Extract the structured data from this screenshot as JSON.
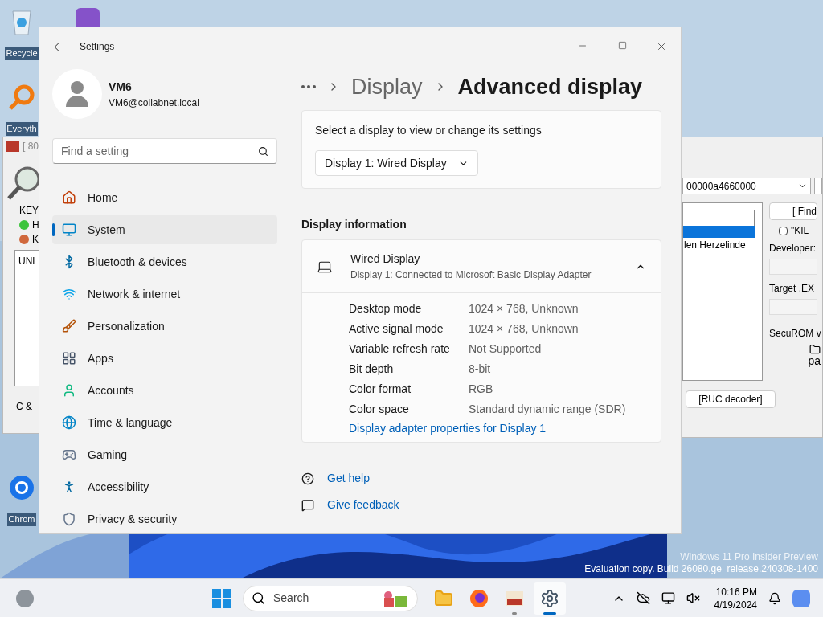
{
  "desktop": {
    "icons": [
      {
        "label": "Recycle"
      },
      {
        "label": "Everyth"
      },
      {
        "label": "Chrom"
      }
    ],
    "watermark": [
      "Windows 11 Pro Insider Preview",
      "Evaluation copy. Build 26080.ge_release.240308-1400"
    ]
  },
  "left_window": {
    "title": "[ 80",
    "group_label": "KEY",
    "lights": [
      {
        "label": "H",
        "color": "#3cc43c"
      },
      {
        "label": "K",
        "color": "#d0683c"
      }
    ],
    "list_text": "UNL",
    "footer": "C &"
  },
  "right_window": {
    "dropdown_value": "00000a4660000",
    "list_items": [
      "len Herzelinde"
    ],
    "find_button": "[ Find",
    "checkbox": {
      "label": "\"KIL",
      "checked": false
    },
    "developer_label": "Developer:",
    "target_label": "Target .EX",
    "securom_label": "SecuROM v",
    "folder_label": "pa",
    "decoder_button": "[RUC decoder]"
  },
  "settings": {
    "title": "Settings",
    "user": {
      "name": "VM6",
      "email": "VM6@collabnet.local"
    },
    "search": {
      "placeholder": "Find a setting"
    },
    "nav": [
      {
        "label": "Home",
        "selected": false
      },
      {
        "label": "System",
        "selected": true
      },
      {
        "label": "Bluetooth & devices",
        "selected": false
      },
      {
        "label": "Network & internet",
        "selected": false
      },
      {
        "label": "Personalization",
        "selected": false
      },
      {
        "label": "Apps",
        "selected": false
      },
      {
        "label": "Accounts",
        "selected": false
      },
      {
        "label": "Time & language",
        "selected": false
      },
      {
        "label": "Gaming",
        "selected": false
      },
      {
        "label": "Accessibility",
        "selected": false
      },
      {
        "label": "Privacy & security",
        "selected": false
      }
    ],
    "breadcrumb": [
      "Display",
      "Advanced display"
    ],
    "select_card": {
      "label": "Select a display to view or change its settings",
      "dropdown": "Display 1: Wired Display"
    },
    "section_title": "Display information",
    "display": {
      "name": "Wired Display",
      "subtitle": "Display 1: Connected to Microsoft Basic Display Adapter",
      "expanded": true,
      "rows": [
        {
          "label": "Desktop mode",
          "value": "1024 × 768, Unknown"
        },
        {
          "label": "Active signal mode",
          "value": "1024 × 768, Unknown"
        },
        {
          "label": "Variable refresh rate",
          "value": "Not Supported"
        },
        {
          "label": "Bit depth",
          "value": "8-bit"
        },
        {
          "label": "Color format",
          "value": "RGB"
        },
        {
          "label": "Color space",
          "value": "Standard dynamic range (SDR)"
        }
      ],
      "link": "Display adapter properties for Display 1"
    },
    "help_links": [
      "Get help",
      "Give feedback"
    ]
  },
  "taskbar": {
    "search": {
      "placeholder": "Search"
    },
    "apps": [
      {
        "selected": false,
        "running": false
      },
      {
        "selected": false,
        "running": false
      },
      {
        "selected": false,
        "running": true
      },
      {
        "selected": true,
        "running": true
      }
    ],
    "time": "10:16 PM",
    "date": "4/19/2024"
  }
}
